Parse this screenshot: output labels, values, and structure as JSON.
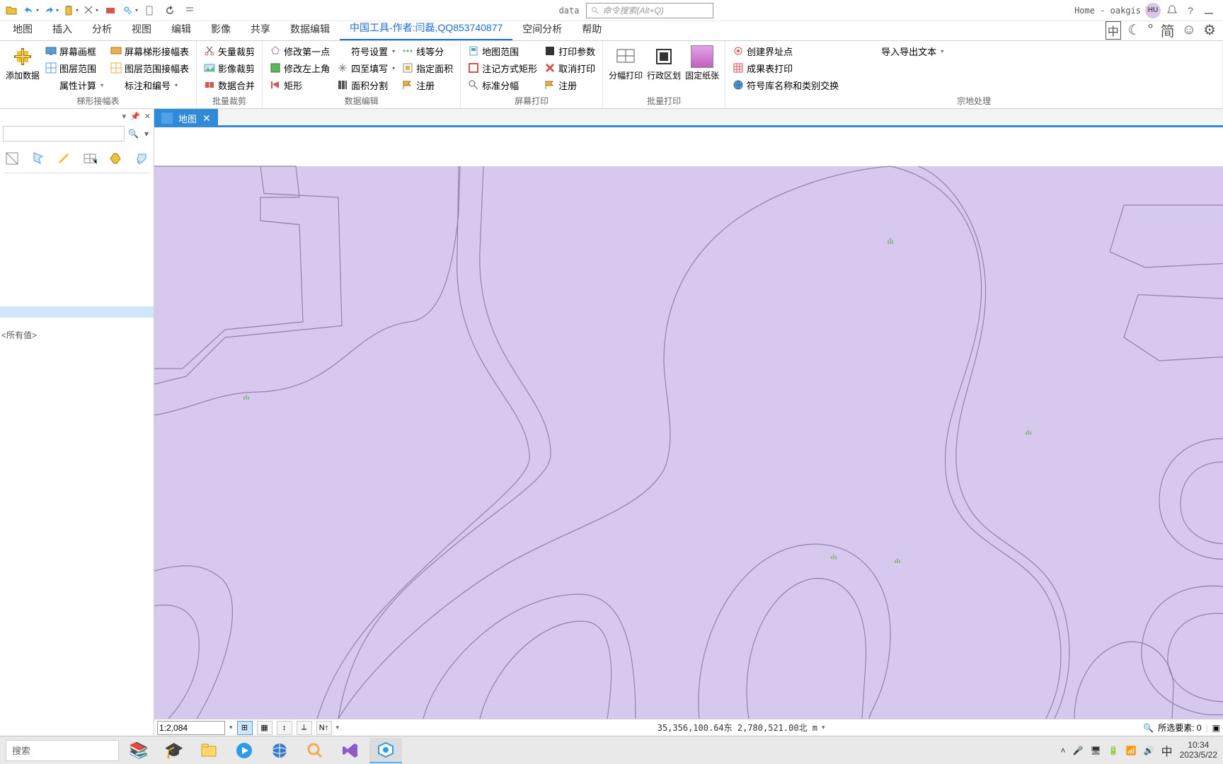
{
  "qat": {
    "data_label": "data"
  },
  "search": {
    "placeholder": "命令搜索(Alt+Q)"
  },
  "title_right": {
    "home": "Home - oakgis",
    "avatar": "HU"
  },
  "tabs": [
    "地图",
    "插入",
    "分析",
    "视图",
    "编辑",
    "影像",
    "共享",
    "数据编辑",
    "中国工具-作者:闫磊,QQ853740877",
    "空间分析",
    "帮助"
  ],
  "active_tab_index": 8,
  "tab_right_buttons": [
    "中",
    "☾",
    "°",
    "简",
    "☺",
    "⚙"
  ],
  "ribbon": {
    "groups": [
      {
        "label": "梯形接幅表",
        "big": [
          {
            "name": "add-data",
            "label": "添加数据",
            "svg": "plus-yellow"
          }
        ],
        "cols": [
          [
            {
              "name": "screen-frame",
              "label": "屏幕画框",
              "icon": "monitor-blue"
            },
            {
              "name": "layer-extent",
              "label": "图层范围",
              "icon": "grid-blue"
            },
            {
              "name": "attr-calc",
              "label": "属性计算",
              "icon": "blank",
              "dd": true
            }
          ],
          [
            {
              "name": "trapezoid-grid",
              "label": "屏幕梯形接幅表",
              "icon": "monitor-orange"
            },
            {
              "name": "layer-extent-grid",
              "label": "图层范围接幅表",
              "icon": "grid-orange"
            },
            {
              "name": "label-number",
              "label": "标注和编号",
              "icon": "blank",
              "dd": true
            }
          ]
        ]
      },
      {
        "label": "批量裁剪",
        "cols": [
          [
            {
              "name": "vector-clip",
              "label": "矢量裁剪",
              "icon": "scissors"
            },
            {
              "name": "image-clip",
              "label": "影像裁剪",
              "icon": "image"
            },
            {
              "name": "data-merge",
              "label": "数据合并",
              "icon": "merge"
            }
          ]
        ]
      },
      {
        "label": "数据编辑",
        "cols": [
          [
            {
              "name": "mod-first-pt",
              "label": "修改第一点",
              "icon": "pentagon"
            },
            {
              "name": "mod-upper-left",
              "label": "修改左上角",
              "icon": "square-green"
            },
            {
              "name": "rectangle",
              "label": "矩形",
              "icon": "flag"
            }
          ],
          [
            {
              "name": "symbol-setting",
              "label": "符号设置",
              "icon": "blank",
              "dd": true
            },
            {
              "name": "four-fill",
              "label": "四至填写",
              "icon": "arrows",
              "dd": true
            },
            {
              "name": "area-division",
              "label": "面积分割",
              "icon": "columns"
            }
          ],
          [
            {
              "name": "line-equal",
              "label": "线等分",
              "icon": "dots"
            },
            {
              "name": "area-specify",
              "label": "指定面积",
              "icon": "grid-select"
            },
            {
              "name": "annotate",
              "label": "注册",
              "icon": "flag-orange"
            }
          ]
        ]
      },
      {
        "label": "屏幕打印",
        "cols": [
          [
            {
              "name": "map-extent",
              "label": "地图范围",
              "icon": "doc-blue"
            },
            {
              "name": "note-rect",
              "label": "注记方式矩形",
              "icon": "square-red"
            },
            {
              "name": "std-frame",
              "label": "标准分幅",
              "icon": "zoom"
            }
          ],
          [
            {
              "name": "print-params",
              "label": "打印参数",
              "icon": "square-black"
            },
            {
              "name": "cancel-print",
              "label": "取消打印",
              "icon": "x-red"
            },
            {
              "name": "register2",
              "label": "注册",
              "icon": "flag-orange"
            }
          ]
        ]
      },
      {
        "label": "批量打印",
        "big": [
          {
            "name": "split-print",
            "label": "分幅打印",
            "svg": "split"
          },
          {
            "name": "admin-print",
            "label": "行政区划",
            "svg": "admin"
          },
          {
            "name": "fixed-paper",
            "label": "固定纸张",
            "svg": "paper",
            "accent": true
          }
        ]
      },
      {
        "label": "宗地处理",
        "cols": [
          [
            {
              "name": "create-boundary",
              "label": "创建界址点",
              "icon": "circle-red"
            },
            {
              "name": "result-print",
              "label": "成果表打印",
              "icon": "table-red"
            },
            {
              "name": "symbol-exchange",
              "label": "符号库名称和类别交换",
              "icon": "globe"
            }
          ],
          [
            {
              "name": "import-export",
              "label": "导入导出文本",
              "icon": "blank",
              "dd": true
            }
          ]
        ]
      }
    ]
  },
  "map_tab": {
    "label": "地图"
  },
  "toc": {
    "lines": [
      "",
      "",
      "",
      "",
      "",
      "",
      "",
      "",
      "",
      "",
      "",
      "",
      "",
      "",
      "",
      "<所有值>"
    ],
    "selected_index": 11
  },
  "status": {
    "scale": "1:2,084",
    "coords": "35,356,100.64东 2,780,521.00北 m",
    "selected": "所选要素: 0"
  },
  "taskbar": {
    "search": "搜索",
    "ime": "中",
    "time": "10:34",
    "date": "2023/5/22"
  }
}
